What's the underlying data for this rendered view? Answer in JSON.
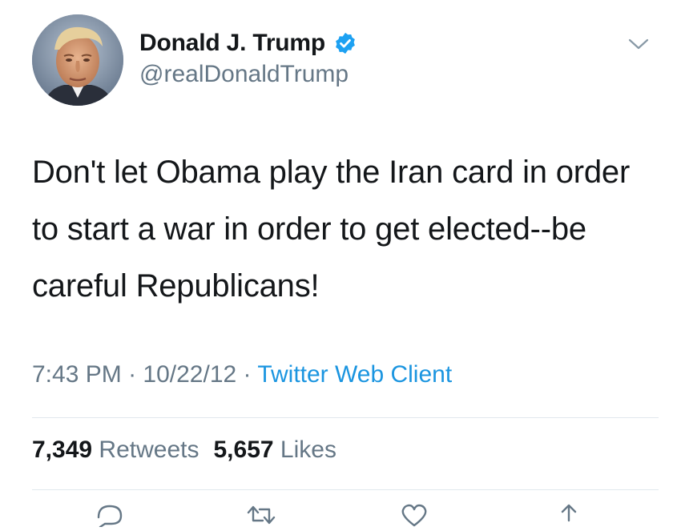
{
  "tweet": {
    "author": {
      "display_name": "Donald J. Trump",
      "handle": "@realDonaldTrump",
      "verified": true,
      "verified_icon": "verified-badge-icon",
      "avatar": "avatar-photo"
    },
    "menu_icon": "chevron-down-icon",
    "text": "Don't let Obama play the Iran card in order to start a war in order to get elected--be careful Republicans!",
    "time": "7:43 PM",
    "separator": " · ",
    "date": "10/22/12",
    "source": "Twitter Web Client",
    "stats": {
      "retweets_count": "7,349",
      "retweets_label": "Retweets",
      "likes_count": "5,657",
      "likes_label": "Likes"
    },
    "actions": [
      {
        "icon": "reply-icon"
      },
      {
        "icon": "retweet-icon"
      },
      {
        "icon": "like-icon"
      },
      {
        "icon": "share-icon"
      }
    ]
  },
  "colors": {
    "text_primary": "#14171a",
    "text_secondary": "#657786",
    "link": "#1b95e0",
    "verified": "#1da1f2",
    "divider": "#e1e8ed"
  }
}
